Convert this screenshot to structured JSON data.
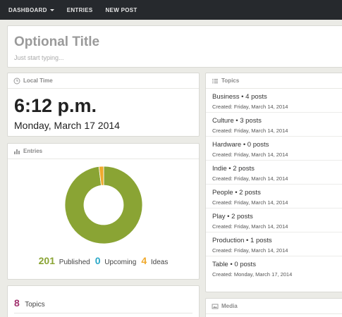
{
  "nav": {
    "items": [
      {
        "label": "DASHBOARD"
      },
      {
        "label": "ENTRIES"
      },
      {
        "label": "NEW POST"
      }
    ]
  },
  "title_panel": {
    "title": "Optional Title",
    "placeholder": "Just start typing..."
  },
  "local_time": {
    "header": "Local Time",
    "time": "6:12 p.m.",
    "date": "Monday, March 17 2014"
  },
  "entries": {
    "header": "Entries",
    "published": {
      "count": "201",
      "label": "Published"
    },
    "upcoming": {
      "count": "0",
      "label": "Upcoming"
    },
    "ideas": {
      "count": "4",
      "label": "Ideas"
    }
  },
  "chart_data": {
    "type": "pie",
    "donut": true,
    "slices": [
      {
        "label": "Published",
        "value": 201,
        "color": "#8aa434"
      },
      {
        "label": "Upcoming",
        "value": 0,
        "color": "#2aa8c8"
      },
      {
        "label": "Ideas",
        "value": 4,
        "color": "#f0a92c"
      }
    ]
  },
  "topics_count": {
    "count": "8",
    "label": "Topics"
  },
  "topics": {
    "header": "Topics",
    "items": [
      {
        "name": "Business • 4 posts",
        "created": "Created: Friday, March 14, 2014"
      },
      {
        "name": "Culture • 3 posts",
        "created": "Created: Friday, March 14, 2014"
      },
      {
        "name": "Hardware • 0 posts",
        "created": "Created: Friday, March 14, 2014"
      },
      {
        "name": "Indie • 2 posts",
        "created": "Created: Friday, March 14, 2014"
      },
      {
        "name": "People • 2 posts",
        "created": "Created: Friday, March 14, 2014"
      },
      {
        "name": "Play • 2 posts",
        "created": "Created: Friday, March 14, 2014"
      },
      {
        "name": "Production • 1 posts",
        "created": "Created: Friday, March 14, 2014"
      },
      {
        "name": "Table • 0 posts",
        "created": "Created: Monday, March 17, 2014"
      }
    ]
  },
  "media": {
    "header": "Media"
  },
  "colors": {
    "nav_bg": "#26292d",
    "published": "#8aa434",
    "upcoming": "#2aa8c8",
    "ideas": "#f0a92c",
    "topics_count": "#a2336f"
  }
}
